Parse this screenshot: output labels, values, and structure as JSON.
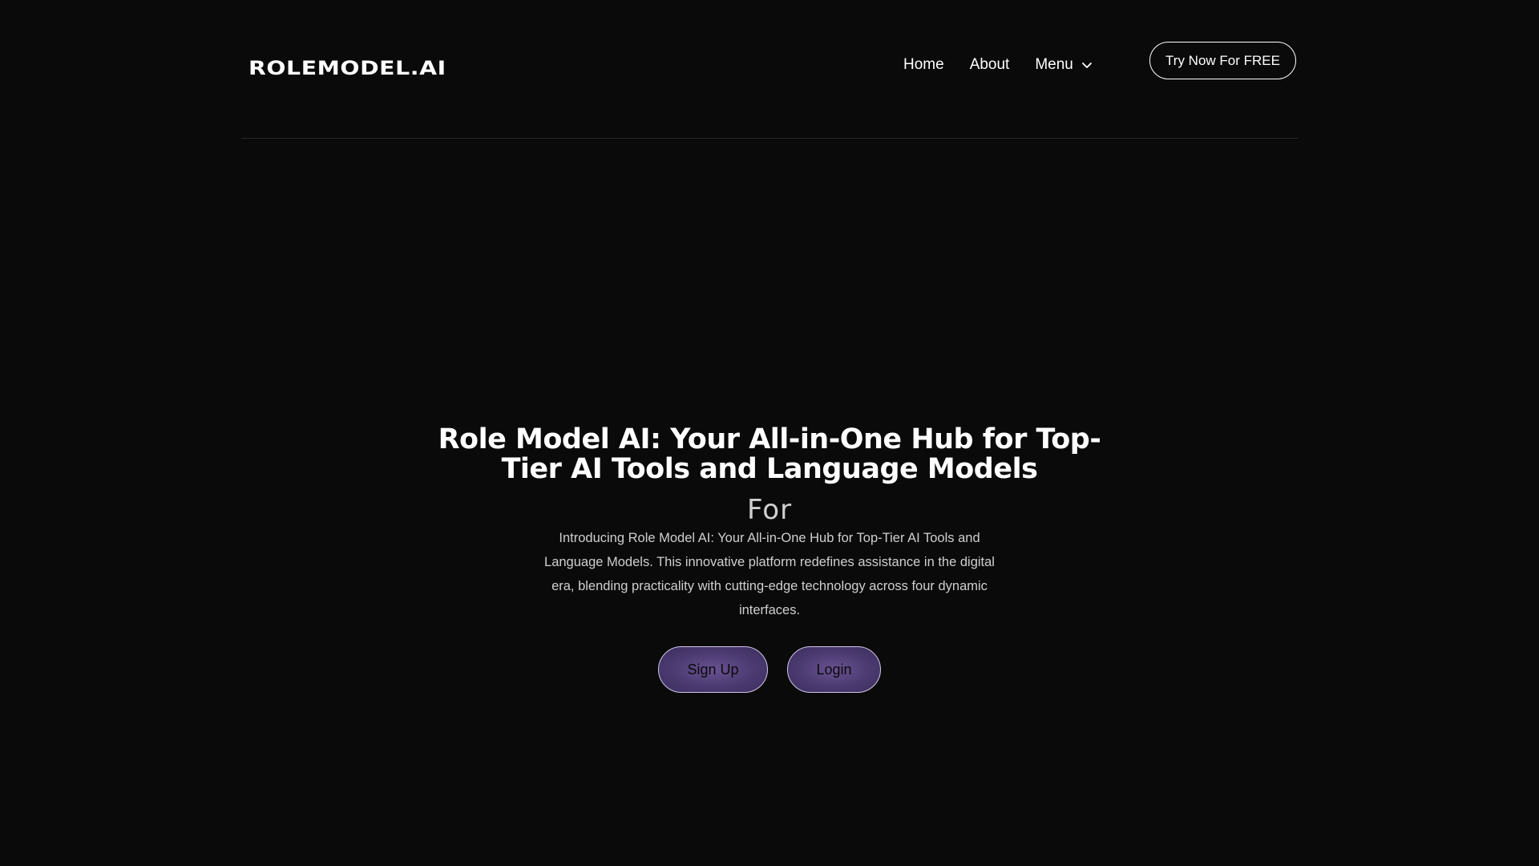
{
  "header": {
    "logo": "ROLEMODEL.AI",
    "nav": {
      "home": "Home",
      "about": "About",
      "menu": "Menu"
    },
    "cta_label": "Try Now For FREE"
  },
  "hero": {
    "title": "Role Model AI: Your All-in-One Hub for Top-Tier AI Tools and Language Models",
    "rotating_word": "For",
    "description": "Introducing Role Model AI: Your All-in-One Hub for Top-Tier AI Tools and Language Models. This innovative platform redefines assistance in the digital era, blending practicality with cutting-edge technology across four dynamic interfaces.",
    "signup_label": "Sign Up",
    "login_label": "Login"
  },
  "colors": {
    "background": "#0a0a0a",
    "text": "#ffffff",
    "button_gradient": "#4a3a70",
    "divider": "#262626"
  },
  "icons": {
    "menu_dropdown": "chevron-down-icon"
  }
}
